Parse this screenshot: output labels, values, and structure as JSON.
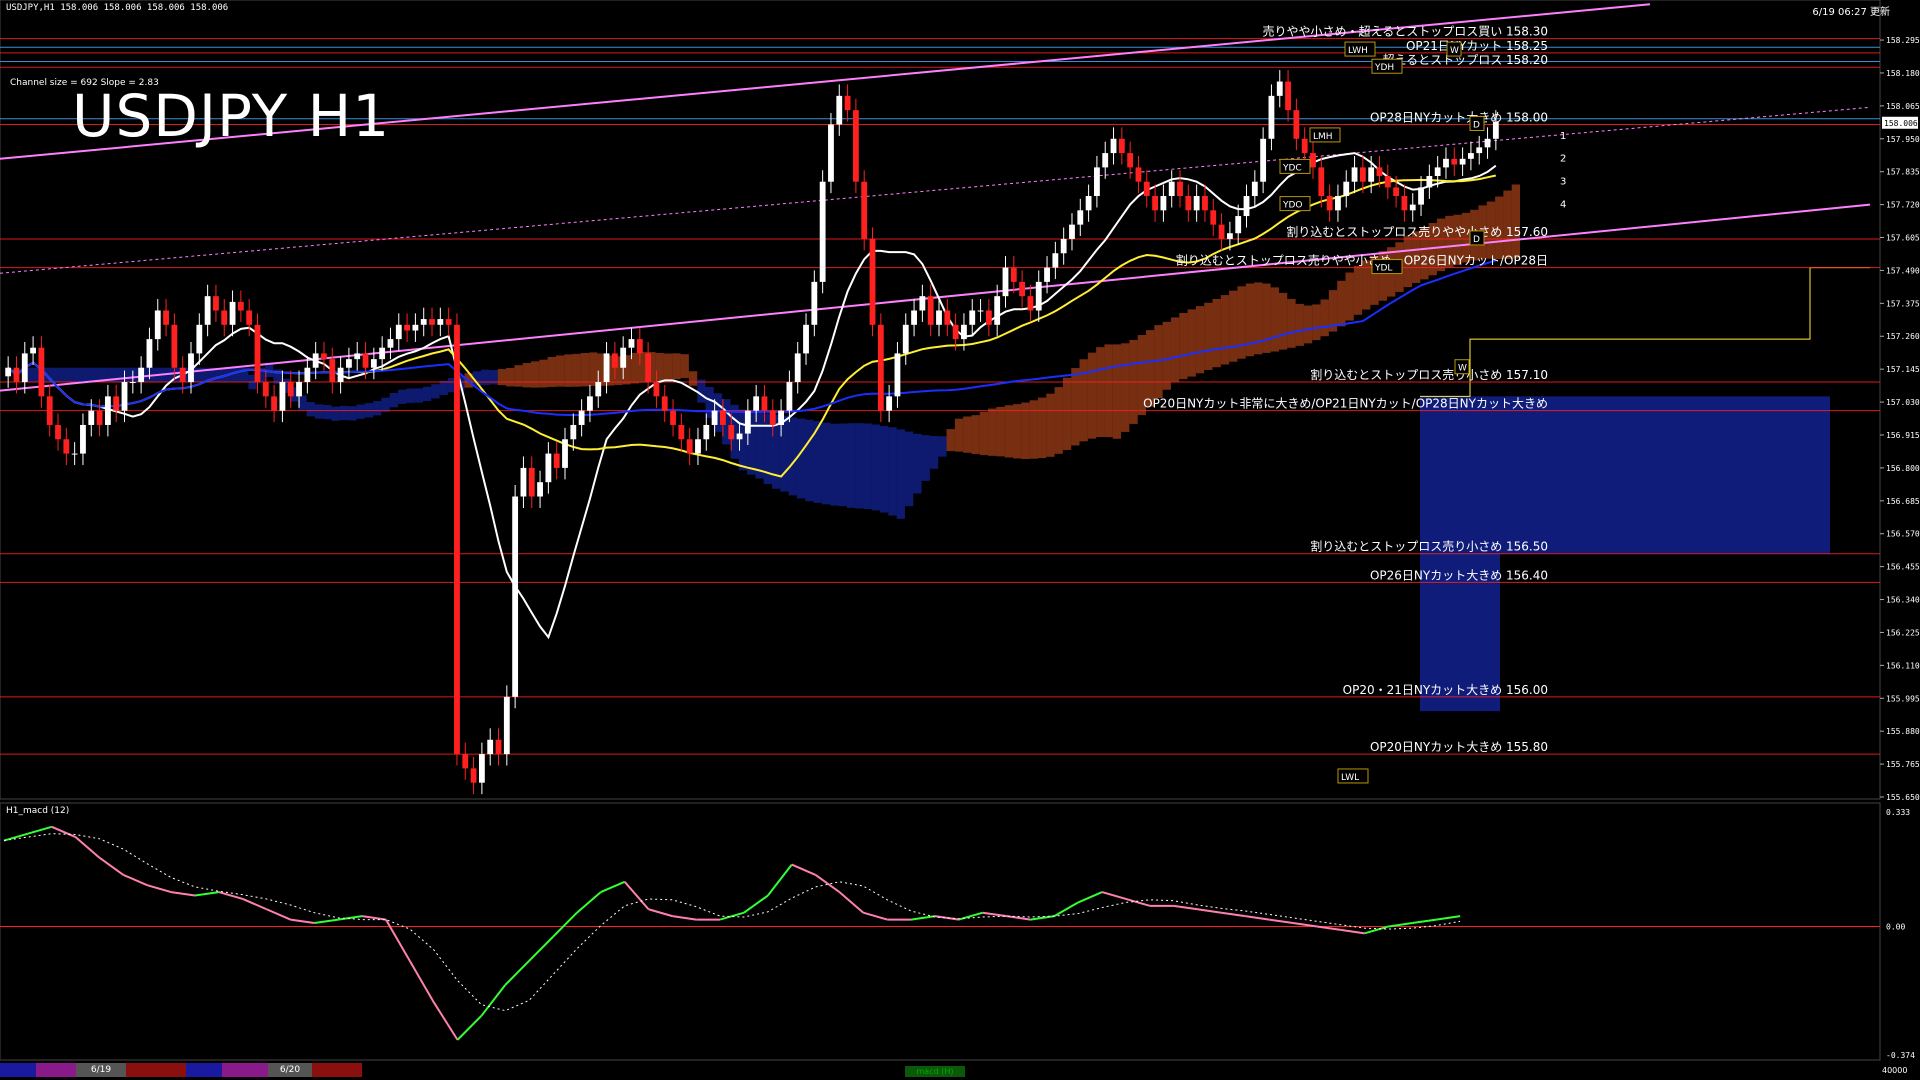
{
  "header": {
    "symbol_info": "USDJPY,H1",
    "ohlc": [
      "158.006",
      "158.006",
      "158.006",
      "158.006"
    ]
  },
  "title": "USDJPY H1",
  "channel_info": "Channel size = 692 Slope = 2.83",
  "timestamp": "6/19 06:27 更新",
  "indicator_label": "H1_macd (12)",
  "bottom_bar": {
    "tabs": [
      "6/19",
      "6/20"
    ],
    "macd_tab": "macd (H)",
    "right_value": "40000"
  },
  "colors": {
    "background": "#000000",
    "bull_candle": "#ffffff",
    "bear_candle": "#ff2020",
    "ma_white": "#ffffff",
    "ma_yellow": "#ffee33",
    "ma_blue": "#1a2fff",
    "channel": "#ff80ff",
    "level_line": "#ff2020",
    "cloud_down": "#d8531f",
    "cloud_up": "#1a2fcc",
    "macd_pink": "#ff80b0",
    "macd_green": "#33ff33"
  },
  "chart_data": [
    {
      "type": "candlestick",
      "name": "USDJPY H1",
      "price_axis": {
        "ylim": [
          155.65,
          158.4
        ],
        "ticks": [
          "158.295",
          "158.180",
          "158.065",
          "157.950",
          "157.835",
          "157.720",
          "157.605",
          "157.490",
          "157.375",
          "157.260",
          "157.145",
          "157.030",
          "156.915",
          "156.800",
          "156.685",
          "156.570",
          "156.455",
          "156.340",
          "156.225",
          "156.110",
          "155.995",
          "155.880",
          "155.765",
          "155.650"
        ],
        "current_price": "158.006"
      },
      "closes": [
        157.15,
        157.1,
        157.2,
        157.22,
        157.05,
        156.95,
        156.9,
        156.85,
        156.85,
        156.95,
        157.0,
        156.95,
        157.05,
        157.0,
        157.1,
        157.1,
        157.15,
        157.25,
        157.35,
        157.3,
        157.15,
        157.1,
        157.2,
        157.3,
        157.4,
        157.35,
        157.3,
        157.38,
        157.35,
        157.3,
        157.1,
        157.05,
        157.0,
        157.1,
        157.05,
        157.1,
        157.15,
        157.2,
        157.18,
        157.1,
        157.15,
        157.18,
        157.2,
        157.15,
        157.18,
        157.22,
        157.25,
        157.3,
        157.28,
        157.3,
        157.32,
        157.3,
        157.32,
        157.3,
        155.8,
        155.75,
        155.7,
        155.8,
        155.85,
        155.8,
        156.0,
        156.7,
        156.8,
        156.7,
        156.75,
        156.85,
        156.8,
        156.9,
        156.95,
        157.0,
        157.05,
        157.1,
        157.2,
        157.15,
        157.22,
        157.25,
        157.2,
        157.1,
        157.05,
        157.0,
        156.95,
        156.9,
        156.85,
        156.9,
        156.95,
        157.0,
        156.95,
        156.9,
        156.92,
        157.0,
        157.05,
        157.0,
        156.95,
        157.0,
        157.1,
        157.2,
        157.3,
        157.45,
        157.8,
        158.0,
        158.1,
        158.05,
        157.8,
        157.6,
        157.3,
        157.0,
        157.05,
        157.2,
        157.3,
        157.35,
        157.4,
        157.3,
        157.35,
        157.3,
        157.25,
        157.3,
        157.35,
        157.35,
        157.3,
        157.4,
        157.5,
        157.45,
        157.4,
        157.35,
        157.45,
        157.5,
        157.55,
        157.6,
        157.65,
        157.7,
        157.75,
        157.85,
        157.9,
        157.95,
        157.9,
        157.85,
        157.8,
        157.75,
        157.7,
        157.75,
        157.8,
        157.75,
        157.7,
        157.75,
        157.7,
        157.65,
        157.6,
        157.62,
        157.68,
        157.75,
        157.8,
        157.95,
        158.1,
        158.15,
        158.05,
        157.95,
        157.9,
        157.85,
        157.75,
        157.7,
        157.75,
        157.8,
        157.85,
        157.8,
        157.85,
        157.82,
        157.78,
        157.75,
        157.7,
        157.72,
        157.78,
        157.82,
        157.85,
        157.88,
        157.86,
        157.88,
        157.9,
        157.92,
        157.95,
        158.01
      ],
      "moving_averages": [
        {
          "name": "white-ma",
          "color": "#ffffff"
        },
        {
          "name": "yellow-ma",
          "color": "#ffee33"
        },
        {
          "name": "blue-ma",
          "color": "#1a2fff"
        }
      ],
      "annotations": [
        {
          "text": "売りやや小さめ・超えるとストップロス買い 158.30",
          "price": 158.3
        },
        {
          "text": "OP21日NYカット 158.25",
          "price": 158.25
        },
        {
          "text": "超えるとストップロス 158.20",
          "price": 158.2
        },
        {
          "text": "OP28日NYカット大きめ 158.00",
          "price": 158.0
        },
        {
          "text": "割り込むとストップロス売りやや小さめ 157.60",
          "price": 157.6
        },
        {
          "text": "割り込むとストップロス売りやや小さめ・OP26日NYカット/OP28日",
          "price": 157.5
        },
        {
          "text": "割り込むとストップロス売り小さめ 157.10",
          "price": 157.1
        },
        {
          "text": "OP20日NYカット非常に大きめ/OP21日NYカット/OP28日NYカット大きめ",
          "price": 157.0
        },
        {
          "text": "割り込むとストップロス売り小さめ 156.50",
          "price": 156.5
        },
        {
          "text": "OP26日NYカット大きめ 156.40",
          "price": 156.4
        },
        {
          "text": "OP20・21日NYカット大きめ 156.00",
          "price": 156.0
        },
        {
          "text": "OP20日NYカット大きめ 155.80",
          "price": 155.8
        }
      ],
      "box_labels": [
        "YDH",
        "LWH",
        "W",
        "LMH",
        "D",
        "YDC",
        "YDO",
        "YDL",
        "D",
        "W",
        "LWL"
      ],
      "channel_numbers": [
        "1",
        "2",
        "3",
        "4"
      ]
    },
    {
      "type": "line",
      "name": "H1_macd (12)",
      "ylim": [
        -0.374,
        0.333
      ],
      "ticks": [
        "0.333",
        "0.00",
        "-0.374"
      ],
      "series": [
        {
          "color": "#ff80b0",
          "values": [
            0.25,
            0.27,
            0.29,
            0.26,
            0.2,
            0.15,
            0.12,
            0.1,
            0.09,
            0.1,
            0.08,
            0.05,
            0.02,
            0.01,
            0.02,
            0.03,
            0.02,
            -0.1,
            -0.22,
            -0.33,
            -0.26,
            -0.17,
            -0.1,
            -0.03,
            0.04,
            0.1,
            0.13,
            0.05,
            0.03,
            0.02,
            0.02,
            0.04,
            0.09,
            0.18,
            0.15,
            0.1,
            0.04,
            0.02,
            0.02,
            0.03,
            0.02,
            0.04,
            0.03,
            0.02,
            0.03,
            0.07,
            0.1,
            0.08,
            0.06,
            0.06,
            0.05,
            0.04,
            0.03,
            0.02,
            0.01,
            0.0,
            -0.01,
            -0.02,
            0.0,
            0.01,
            0.02,
            0.03
          ]
        }
      ]
    }
  ]
}
